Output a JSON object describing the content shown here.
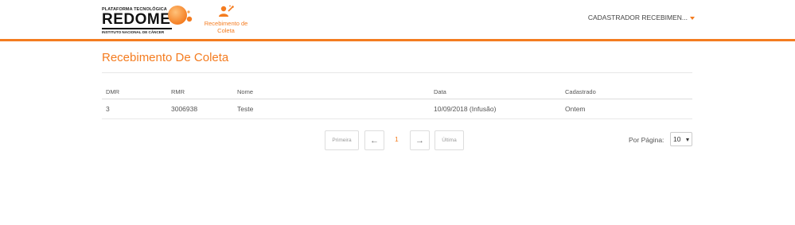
{
  "brand": {
    "top_line": "PLATAFORMA TECNOLÓGICA",
    "name": "REDOME",
    "subtitle": "INSTITUTO NACIONAL DE CÂNCER",
    "accent": "#f47c20"
  },
  "nav": {
    "items": [
      {
        "label": "Recebimento de Coleta",
        "icon": "user-collection-icon"
      }
    ]
  },
  "user_menu": {
    "label": "CADASTRADOR RECEBIMEN..."
  },
  "page": {
    "title": "Recebimento De Coleta"
  },
  "table": {
    "columns": [
      "DMR",
      "RMR",
      "Nome",
      "Data",
      "Cadastrado"
    ],
    "rows": [
      [
        "3",
        "3006938",
        "Teste",
        "10/09/2018 (Infusão)",
        "Ontem"
      ]
    ]
  },
  "pagination": {
    "first_label": "Primeira",
    "prev_icon": "arrow-left-icon",
    "current_page": "1",
    "next_icon": "arrow-right-icon",
    "last_label": "Última"
  },
  "per_page": {
    "label": "Por Página:",
    "value": "10"
  }
}
